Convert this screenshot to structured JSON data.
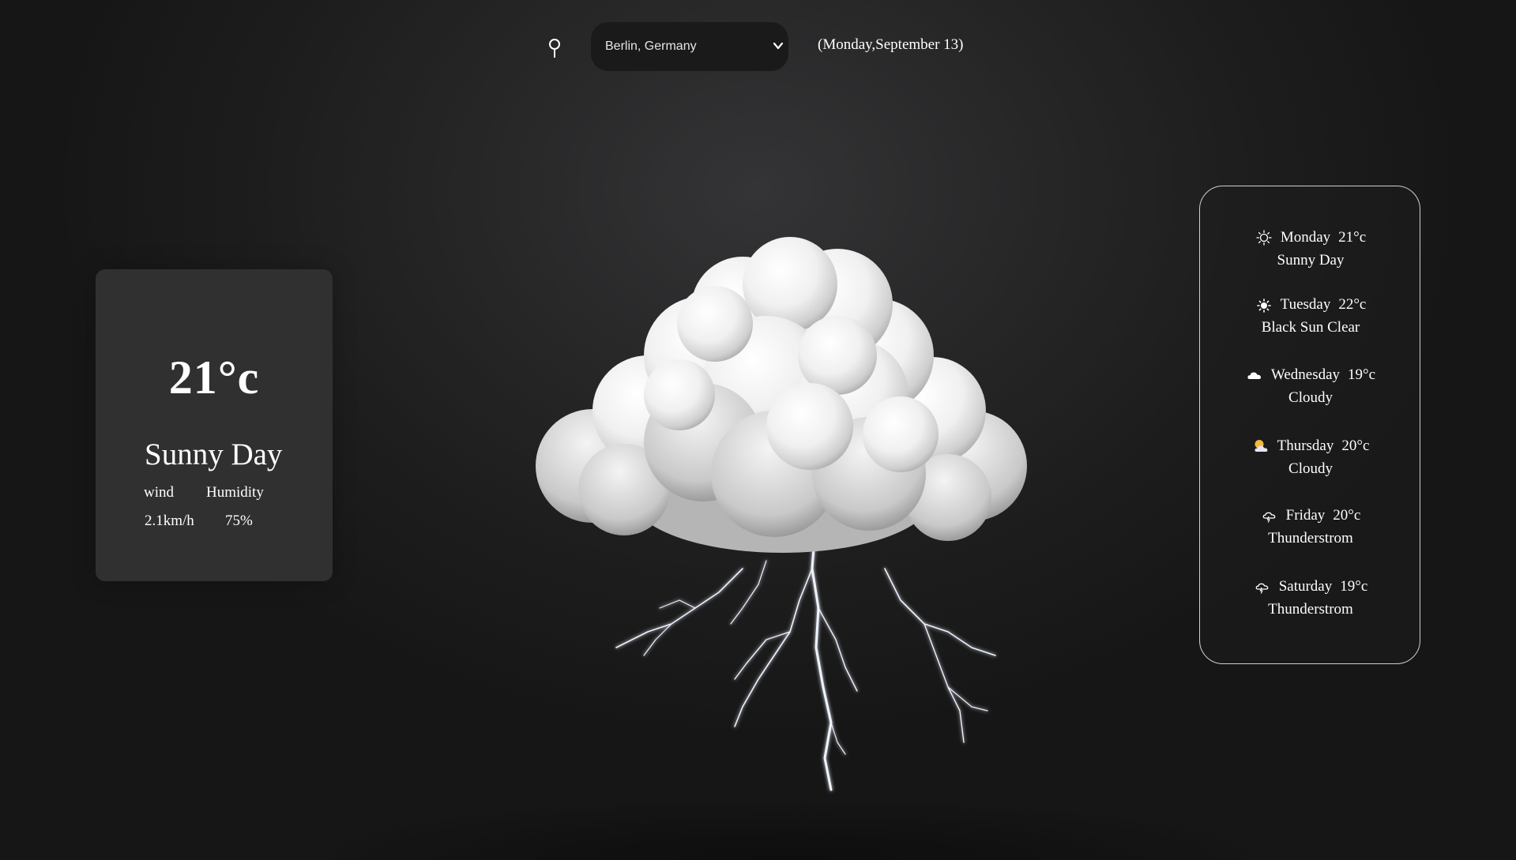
{
  "header": {
    "location_value": "Berlin, Germany",
    "date_text": "(Monday,September 13)"
  },
  "current": {
    "temperature": "21°c",
    "condition": "Sunny Day",
    "wind_label": "wind",
    "humidity_label": "Humidity",
    "wind_value": "2.1km/h",
    "humidity_value": "75%"
  },
  "forecast": [
    {
      "day": "Monday",
      "temp": "21°c",
      "condition": "Sunny Day",
      "icon": "sun-outline-icon"
    },
    {
      "day": "Tuesday",
      "temp": "22°c",
      "condition": "Black Sun Clear",
      "icon": "black-sun-icon"
    },
    {
      "day": "Wednesday",
      "temp": "19°c",
      "condition": "Cloudy",
      "icon": "cloud-icon"
    },
    {
      "day": "Thursday",
      "temp": "20°c",
      "condition": "Cloudy",
      "icon": "sun-behind-cloud-icon"
    },
    {
      "day": "Friday",
      "temp": "20°c",
      "condition": "Thunderstrom",
      "icon": "thunder-cloud-icon"
    },
    {
      "day": "Saturday",
      "temp": "19°c",
      "condition": "Thunderstrom",
      "icon": "thunder-cloud-icon"
    }
  ],
  "colors": {
    "background": "#1b1b1b",
    "card": "#303030",
    "panel_border": "#cfcfcf",
    "text": "#ffffff"
  }
}
